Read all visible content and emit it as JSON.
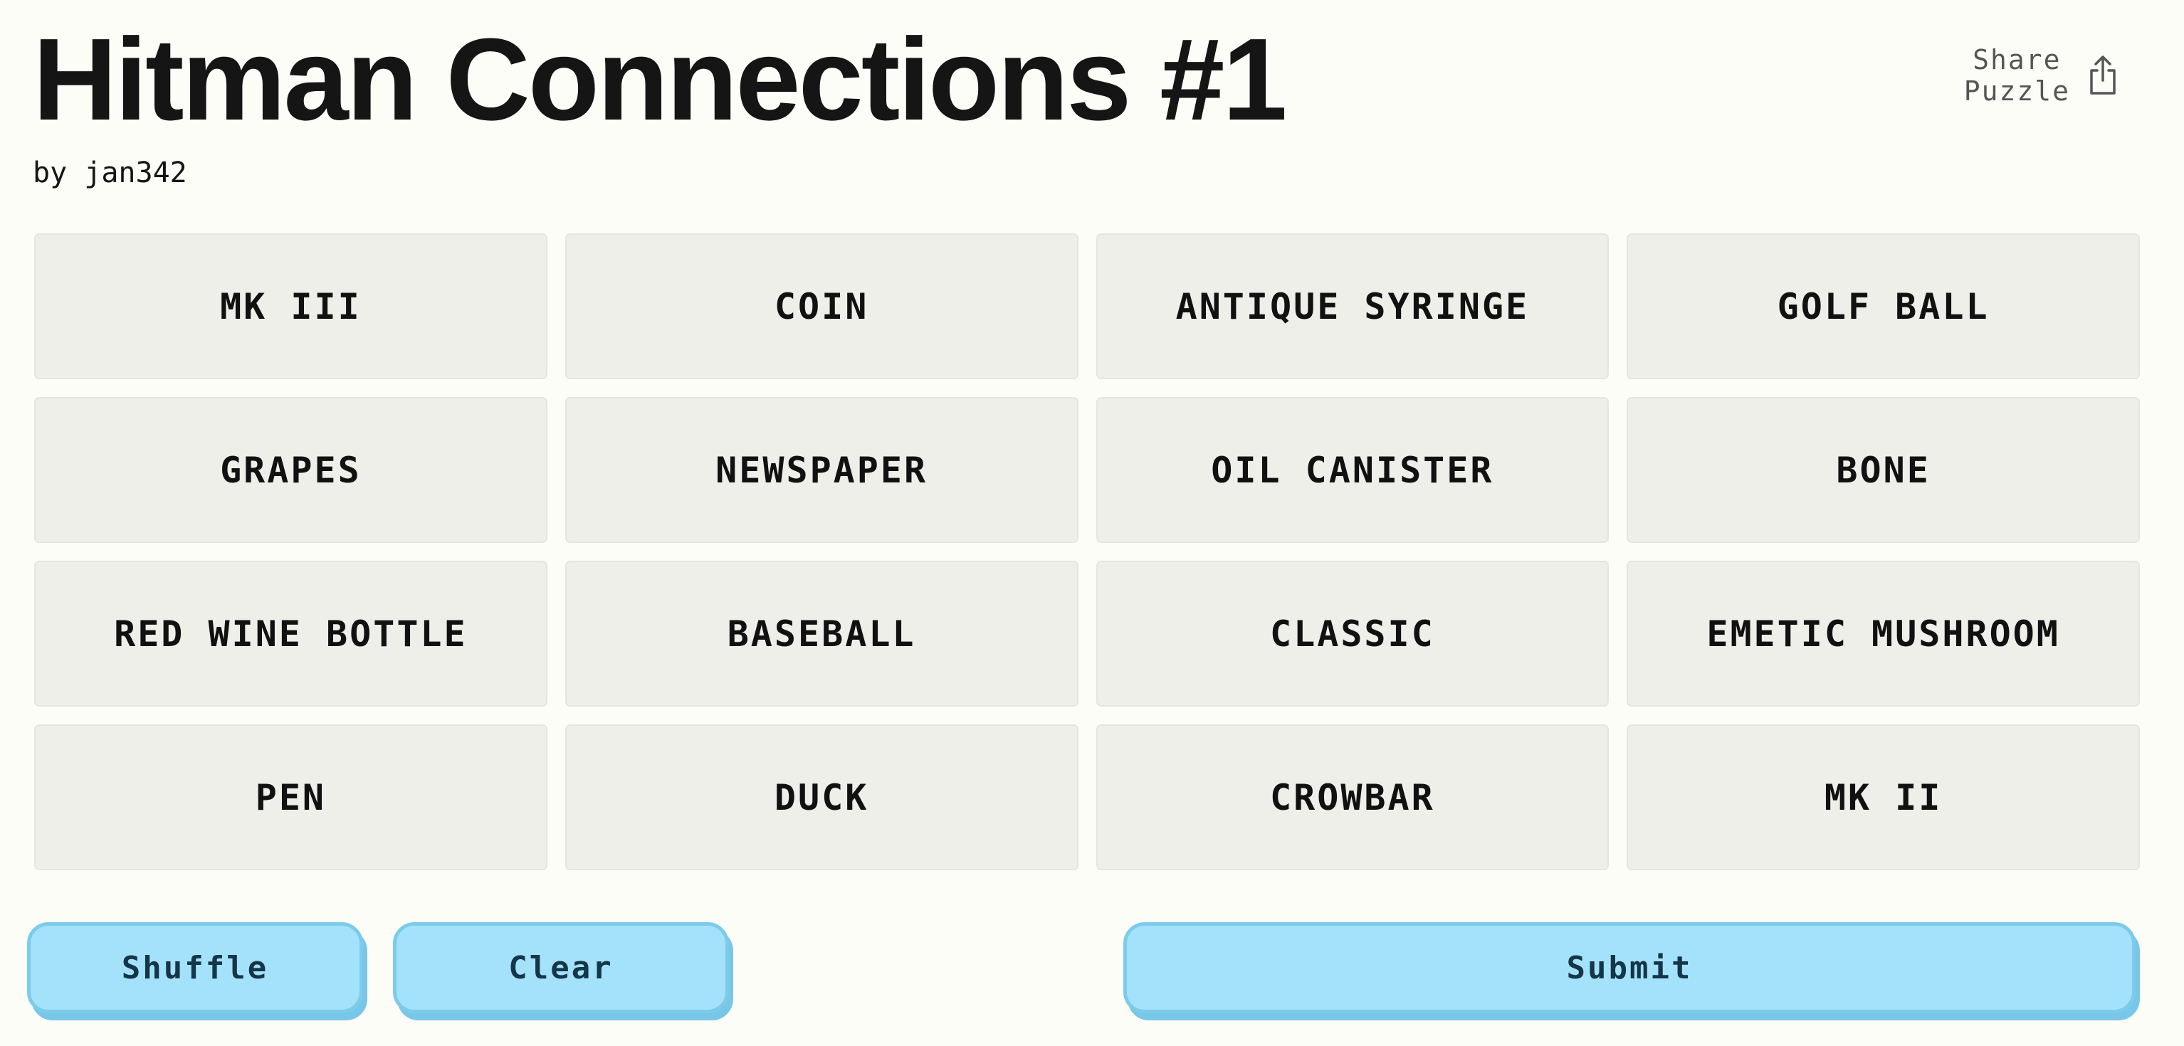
{
  "header": {
    "title": "Hitman Connections #1",
    "byline": "by jan342",
    "share_line1": "Share",
    "share_line2": "Puzzle",
    "share_icon": "share-icon"
  },
  "tiles": [
    "MK III",
    "COIN",
    "ANTIQUE SYRINGE",
    "GOLF BALL",
    "GRAPES",
    "NEWSPAPER",
    "OIL CANISTER",
    "BONE",
    "RED WINE BOTTLE",
    "BASEBALL",
    "CLASSIC",
    "EMETIC MUSHROOM",
    "PEN",
    "DUCK",
    "CROWBAR",
    "MK II"
  ],
  "actions": {
    "shuffle": "Shuffle",
    "clear": "Clear",
    "submit": "Submit"
  },
  "colors": {
    "background": "#fdfdf8",
    "tile": "#efefe9",
    "button": "#a4e2fb",
    "button_border": "#7ccbea",
    "button_text": "#153648"
  }
}
